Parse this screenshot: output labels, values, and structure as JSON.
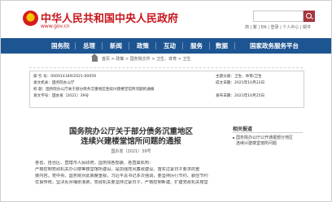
{
  "header": {
    "site_title": "中华人民共和国中央人民政府",
    "site_url": "www.gov.cn",
    "header_links": "简 | 繁 | EN | 登录 | 个人中心 | 邮件"
  },
  "nav": {
    "items": [
      "国务院",
      "总理",
      "新闻",
      "政策",
      "互动",
      "服务",
      "数据",
      "国情"
    ],
    "english_link": "国家政务服务平台"
  },
  "breadcrumb": "首页 > 政策 > 国务院文件 > 卫生、体育 > 卫生",
  "info_table": {
    "rows": [
      "索 引 号：000014349/2021-00059",
      "发文机关：国务院办公厅",
      "标    题：国务院办公厅关于部分债务沉重地区连续兴建楼堂馆所问题的通报",
      "发文字号：国办发〔2021〕39号"
    ],
    "right_rows": [
      "主题分类：卫生、体育/卫生",
      "成文日期：2021年10月22日",
      "发布日期：2021年10月25日"
    ]
  },
  "article": {
    "title_line1": "国务院办公厅关于部分债务沉重地区",
    "title_line2": "连续兴建楼堂馆所问题的通报",
    "doc_number": "国办发〔2021〕39号",
    "body_lines": [
      "各省、自治区、直辖市人民政府，国务院各部委、各直属机构：",
      "    严格控制党政机关办公楼等楼堂馆所建设，是加强党风廉政建设、落实过紧日子要求的重",
      "要内容。党中央、国务院对此高度重视，习近平总书记多次强调，要坚持厉行节约、勤俭节约",
      "优良传统，坚决反对铺张浪费，党政机关要坚持过紧日子，严格控制新建、扩建党政机关楼堂"
    ]
  },
  "related": {
    "title": "相关报道",
    "links": [
      "国务院办公厅公开通报部分地区",
      "连续兴建楼堂馆所问题"
    ]
  }
}
